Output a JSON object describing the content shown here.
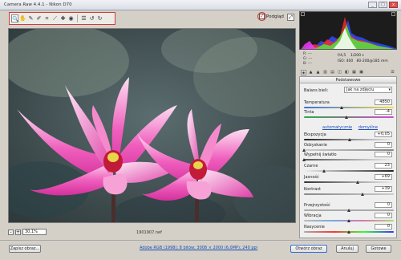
{
  "window": {
    "title": "Camera Raw 4.4.1 - Nikon D70",
    "buttons": {
      "minimize": "_",
      "maximize": "□",
      "close": "x"
    }
  },
  "toolbar": {
    "tools": [
      {
        "name": "zoom-tool",
        "glyph": "🔍",
        "active": true
      },
      {
        "name": "hand-tool",
        "glyph": "✋"
      },
      {
        "name": "white-balance-tool",
        "glyph": "✎"
      },
      {
        "name": "color-sampler-tool",
        "glyph": "✐"
      },
      {
        "name": "crop-tool",
        "glyph": "⌗"
      },
      {
        "name": "straighten-tool",
        "glyph": "⟋"
      },
      {
        "name": "retouch-tool",
        "glyph": "✚"
      },
      {
        "name": "red-eye-tool",
        "glyph": "◉"
      },
      {
        "name": "preferences",
        "glyph": "☰"
      },
      {
        "name": "rotate-left",
        "glyph": "↺"
      },
      {
        "name": "rotate-right",
        "glyph": "↻"
      }
    ]
  },
  "preview": {
    "label": "Podgląd",
    "checked": true
  },
  "image": {
    "filename": "1901907.nef",
    "zoom": "30,1%",
    "zoom_minus": "-",
    "zoom_plus": "+"
  },
  "camera_info": {
    "r_label": "R:",
    "g_label": "G:",
    "b_label": "B:",
    "r_value": "---",
    "g_value": "---",
    "b_value": "---",
    "aperture": "f/4,5",
    "shutter": "1/200 s",
    "iso": "ISO: 400",
    "lens": "80-200@185 mm"
  },
  "panel": {
    "title": "Podstawowe",
    "white_balance_label": "Balans bieli:",
    "white_balance_value": "Jak na zdjęciu",
    "auto_link": "automatycznie",
    "default_link": "domyślne",
    "sliders": [
      {
        "key": "temperature",
        "label": "Temperatura",
        "value": "4850",
        "pos": 0.42
      },
      {
        "key": "tint",
        "label": "Tinta",
        "value": "-4",
        "pos": 0.48
      },
      {
        "key": "exposure",
        "label": "Ekspozycja",
        "value": "+0,05",
        "pos": 0.51
      },
      {
        "key": "recovery",
        "label": "Odzyskanie",
        "value": "0",
        "pos": 0.0
      },
      {
        "key": "fill-light",
        "label": "Wypełnij światło",
        "value": "0",
        "pos": 0.0
      },
      {
        "key": "blacks",
        "label": "Czarne",
        "value": "23",
        "pos": 0.23
      },
      {
        "key": "brightness",
        "label": "Jasność",
        "value": "+69",
        "pos": 0.6
      },
      {
        "key": "contrast",
        "label": "Kontrast",
        "value": "+39",
        "pos": 0.66
      },
      {
        "key": "clarity",
        "label": "Przejrzystość",
        "value": "0",
        "pos": 0.5
      },
      {
        "key": "vibrance",
        "label": "Wibracja",
        "value": "0",
        "pos": 0.5
      },
      {
        "key": "saturation",
        "label": "Nasycenie",
        "value": "0",
        "pos": 0.5
      }
    ]
  },
  "bottom": {
    "save_label": "Zapisz obraz...",
    "workflow_link": "Adobe RGB (1998); 8 bitów; 3008 × 2000 (6,0MP); 240 ppi",
    "open_label": "Otwórz obraz",
    "cancel_label": "Anuluj",
    "done_label": "Gotowe"
  },
  "colors": {
    "accent": "#d23b3b",
    "link": "#1a4fb5"
  }
}
